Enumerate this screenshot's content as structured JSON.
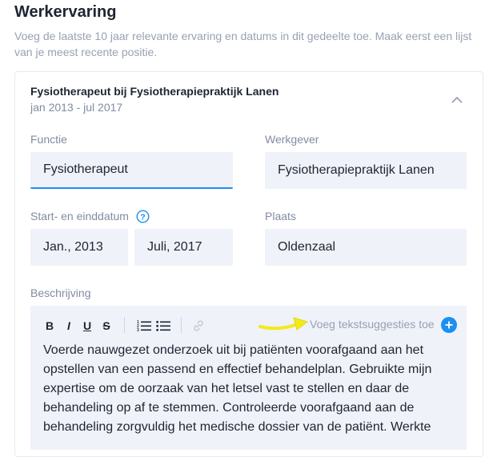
{
  "section": {
    "title": "Werkervaring",
    "description": "Voeg de laatste 10 jaar relevante ervaring en datums in dit gedeelte toe. Maak eerst een lijst van je meest recente positie."
  },
  "job": {
    "heading": "Fysiotherapeut bij Fysiotherapiepraktijk Lanen",
    "dates": "jan 2013 - jul 2017",
    "collapse_icon": "chevron-up-icon",
    "function": {
      "label": "Functie",
      "value": "Fysiotherapeut"
    },
    "employer": {
      "label": "Werkgever",
      "value": "Fysiotherapiepraktijk Lanen"
    },
    "period": {
      "label": "Start- en einddatum",
      "help_icon": "question-circle-icon",
      "start": "Jan., 2013",
      "end": "Juli, 2017"
    },
    "place": {
      "label": "Plaats",
      "value": "Oldenzaal"
    },
    "description": {
      "label": "Beschrijving",
      "toolbar": {
        "bold": "B",
        "italic": "I",
        "underline": "U",
        "strikethrough": "S",
        "ordered_list_icon": "ordered-list-icon",
        "bullet_list_icon": "bullet-list-icon",
        "link_icon": "link-icon"
      },
      "suggestions_label": "Voeg tekstsuggesties toe",
      "suggestions_icon": "plus-circle-icon",
      "text": "Voerde nauwgezet onderzoek uit bij patiënten voorafgaand aan het opstellen van een passend en effectief behandelplan. Gebruikte mijn expertise om de oorzaak van het letsel vast te stellen en daar de behandeling op af te stemmen. Controleerde voorafgaand aan de behandeling zorgvuldig het medische dossier van de patiënt. Werkte"
    }
  },
  "colors": {
    "accent": "#1a91f0",
    "field_bg": "#eff2f9",
    "muted_text": "#98a1b3",
    "annotation_arrow": "#f3ea1c"
  }
}
